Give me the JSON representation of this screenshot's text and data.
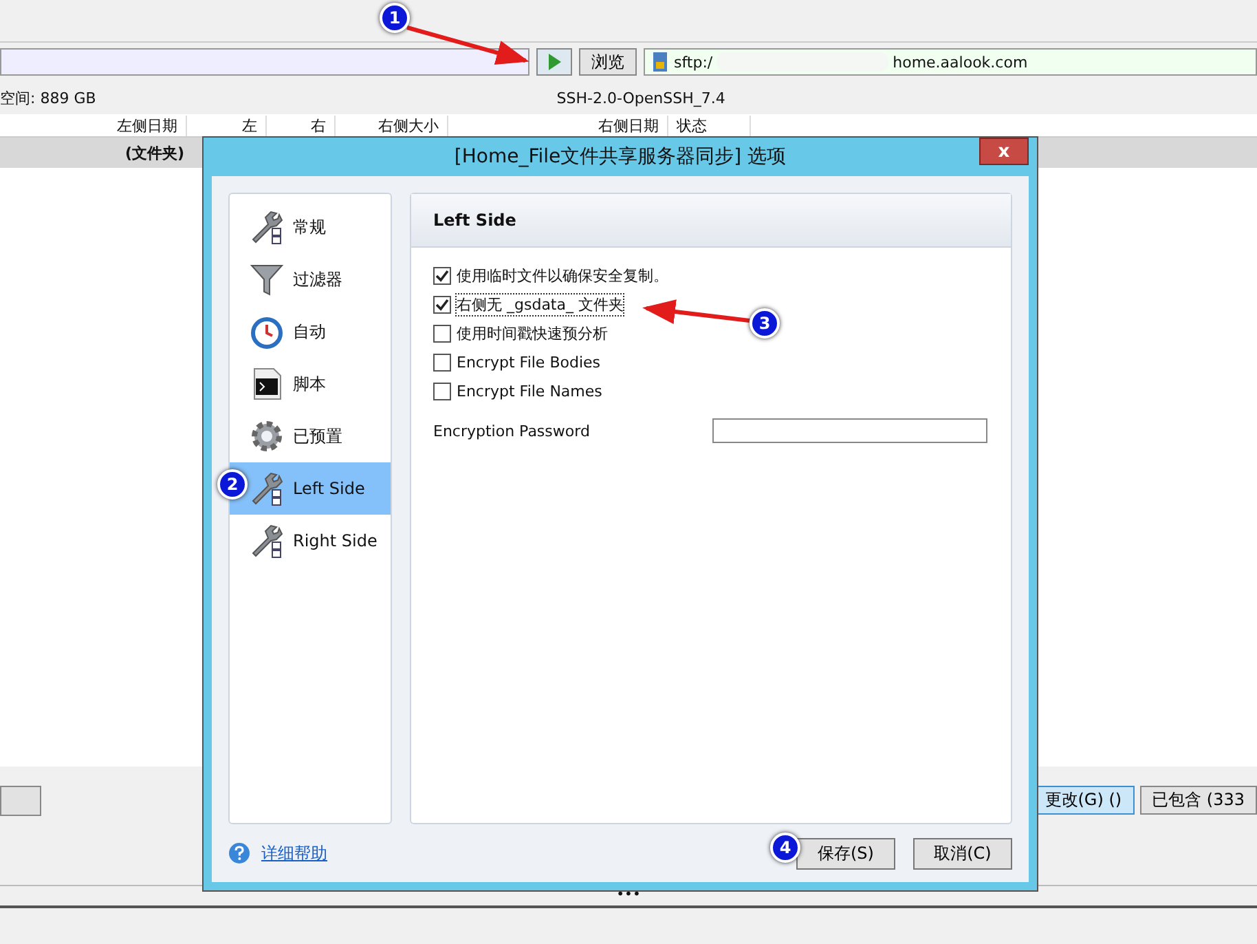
{
  "background_window": {
    "browse_button": "浏览",
    "remote_url_start": "sftp:/",
    "remote_url_end": "home.aalook.com",
    "free_space": "空间: 889 GB",
    "ssh_version": "SSH-2.0-OpenSSH_7.4",
    "columns": [
      "左侧日期",
      "左",
      "右",
      "右侧大小",
      "右侧日期",
      "状态"
    ],
    "rows": [
      {
        "name": "(文件夹)"
      }
    ],
    "bottom_buttons": [
      {
        "label": "更改(G) ()",
        "selected": true
      },
      {
        "label": "已包含 (333",
        "selected": false
      }
    ],
    "splitter": "•••"
  },
  "dialog": {
    "title": "[Home_File文件共享服务器同步] 选项",
    "close": "x",
    "nav": [
      {
        "label": "常规",
        "kind": "wrench",
        "selected": false
      },
      {
        "label": "过滤器",
        "kind": "funnel",
        "selected": false
      },
      {
        "label": "自动",
        "kind": "clock",
        "selected": false
      },
      {
        "label": "脚本",
        "kind": "terminal",
        "selected": false
      },
      {
        "label": "已预置",
        "kind": "gear",
        "selected": false
      },
      {
        "label": "Left Side",
        "kind": "wrench",
        "selected": true
      },
      {
        "label": "Right Side",
        "kind": "wrench",
        "selected": false
      }
    ],
    "panel_title": "Left Side",
    "options": [
      {
        "label": "使用临时文件以确保安全复制。",
        "checked": true
      },
      {
        "label": "右侧无 _gsdata_ 文件夹",
        "checked": true
      },
      {
        "label": "使用时间戳快速预分析",
        "checked": false
      },
      {
        "label": "Encrypt File Bodies",
        "checked": false
      },
      {
        "label": "Encrypt File Names",
        "checked": false
      }
    ],
    "password_label": "Encryption Password",
    "help_link": "详细帮助",
    "buttons": [
      "保存(S)",
      "取消(C)"
    ]
  },
  "annotations": [
    {
      "number": "1"
    },
    {
      "number": "2"
    },
    {
      "number": "3"
    },
    {
      "number": "4"
    }
  ]
}
